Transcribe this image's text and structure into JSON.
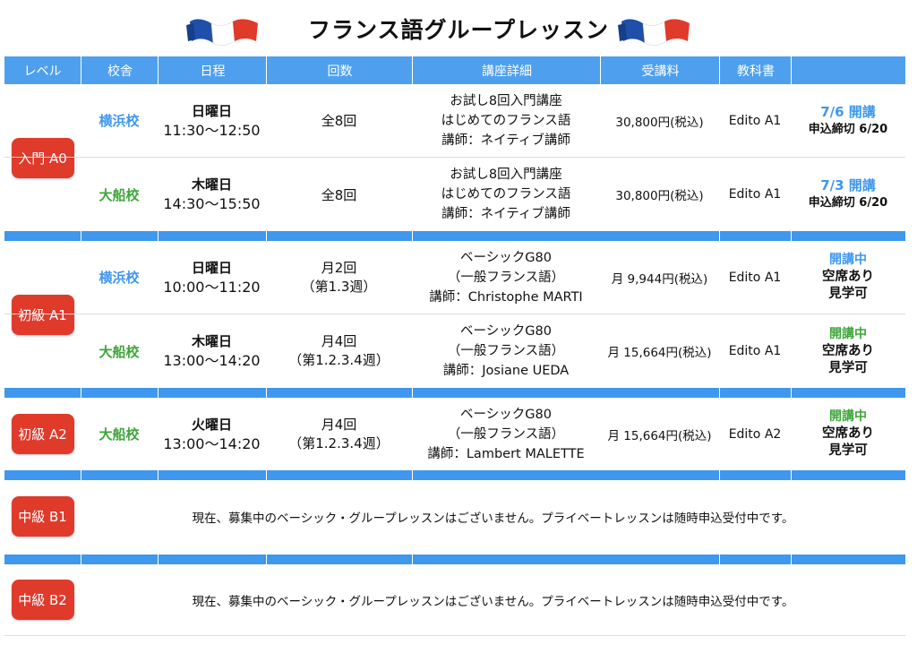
{
  "title": "フランス語グループレッスン",
  "colors": {
    "header_bg": "#4ea0ef",
    "badge": "#e03a2b",
    "blue": "#3f97ee",
    "green": "#3ea63a"
  },
  "header": {
    "level": "レベル",
    "campus": "校舎",
    "schedule": "日程",
    "count": "回数",
    "detail": "講座詳細",
    "fee": "受講料",
    "book": "教科書",
    "status": ""
  },
  "levels": {
    "a0": "入門 A0",
    "a1": "初級 A1",
    "a2": "初級 A2",
    "b1": "中級 B1",
    "b2": "中級 B2"
  },
  "rows": [
    {
      "campus": "横浜校",
      "day": "日曜日",
      "time": "11:30〜12:50",
      "count": "全8回",
      "count_sub": "",
      "detail": [
        "お試し8回入門講座",
        "はじめてのフランス語",
        "講師：ネイティブ講師"
      ],
      "fee": "30,800円(税込)",
      "book": "Edito A1",
      "status": [
        "7/6 開講",
        "申込締切 6/20"
      ]
    },
    {
      "campus": "大船校",
      "day": "木曜日",
      "time": "14:30〜15:50",
      "count": "全8回",
      "count_sub": "",
      "detail": [
        "お試し8回入門講座",
        "はじめてのフランス語",
        "講師：ネイティブ講師"
      ],
      "fee": "30,800円(税込)",
      "book": "Edito A1",
      "status": [
        "7/3 開講",
        "申込締切 6/20"
      ]
    },
    {
      "campus": "横浜校",
      "day": "日曜日",
      "time": "10:00〜11:20",
      "count": "月2回",
      "count_sub": "（第1.3週）",
      "detail": [
        "ベーシックG80",
        "（一般フランス語）",
        "講師：Christophe MARTI"
      ],
      "fee": "月 9,944円(税込)",
      "book": "Edito A1",
      "status": [
        "開講中",
        "空席あり",
        "見学可"
      ]
    },
    {
      "campus": "大船校",
      "day": "木曜日",
      "time": "13:00〜14:20",
      "count": "月4回",
      "count_sub": "（第1.2.3.4週）",
      "detail": [
        "ベーシックG80",
        "（一般フランス語）",
        "講師：Josiane UEDA"
      ],
      "fee": "月 15,664円(税込)",
      "book": "Edito A1",
      "status": [
        "開講中",
        "空席あり",
        "見学可"
      ]
    },
    {
      "campus": "大船校",
      "day": "火曜日",
      "time": "13:00〜14:20",
      "count": "月4回",
      "count_sub": "（第1.2.3.4週）",
      "detail": [
        "ベーシックG80",
        "（一般フランス語）",
        "講師：Lambert MALETTE"
      ],
      "fee": "月 15,664円(税込)",
      "book": "Edito A2",
      "status": [
        "開講中",
        "空席あり",
        "見学可"
      ]
    }
  ],
  "notice": "現在、募集中のベーシック・グループレッスンはございません。プライベートレッスンは随時申込受付中です。"
}
